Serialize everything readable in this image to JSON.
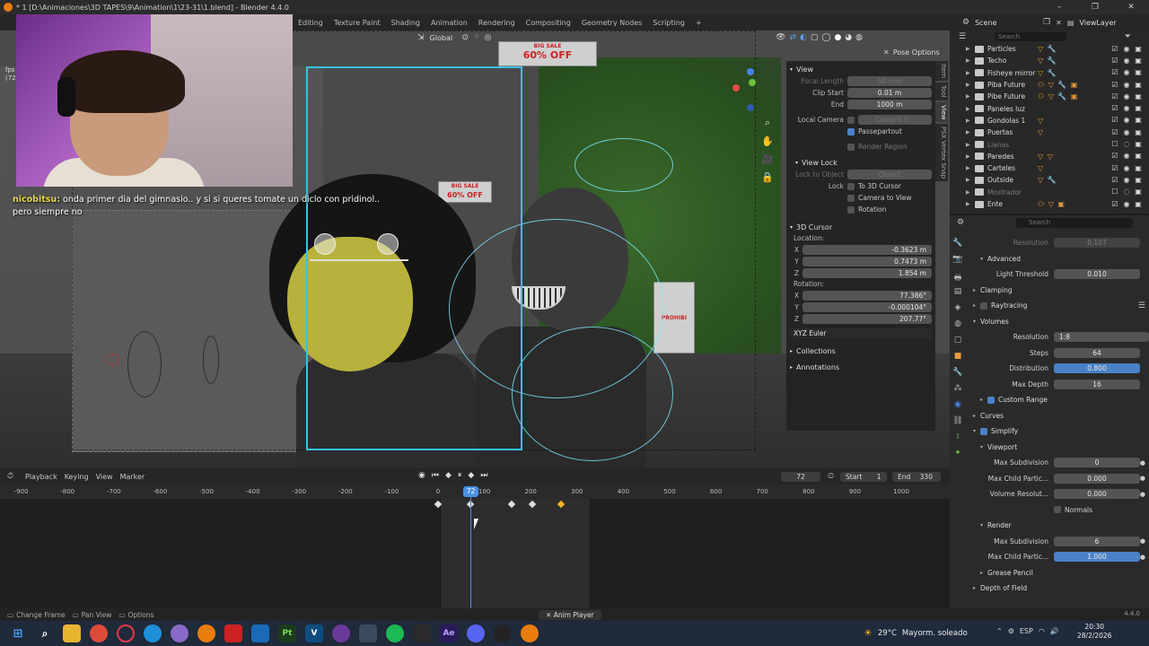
{
  "window": {
    "title": "* 1 [D:\\Animaciones\\3D TAPES\\9\\Animation\\1\\23-31\\1.blend] - Blender 4.4.0",
    "minimize": "–",
    "maximize": "❐",
    "close": "✕"
  },
  "workspaces": [
    "Editing",
    "Texture Paint",
    "Shading",
    "Animation",
    "Rendering",
    "Compositing",
    "Geometry Nodes",
    "Scripting",
    "+"
  ],
  "scene": {
    "scene_label": "Scene",
    "viewlayer_label": "ViewLayer"
  },
  "viewport_header": {
    "orientation": "Global",
    "pose_options": "Pose Options"
  },
  "webcam_overlay": {
    "fps_label": "fps",
    "fps_value": "(72"
  },
  "chat": {
    "nick": "nicobitsu:",
    "message": "onda primer dia del gimnasio.. y si si queres tomate un diclo con pridinol..",
    "message2": "pero siempre no"
  },
  "scene_signs": {
    "sale1_big": "BIG SALE",
    "sale1_pct": "60% OFF",
    "sale2_big": "BIG SALE",
    "sale2_pct": "60% OFF",
    "prohib": "PROHIBI"
  },
  "npanel": {
    "view": {
      "title": "View",
      "focal_length_label": "Focal Length",
      "focal_length": "50 mm",
      "clip_start_label": "Clip Start",
      "clip_start": "0.01 m",
      "end_label": "End",
      "end": "1000 m",
      "local_camera_label": "Local Camera",
      "local_camera": "Camera.0...",
      "passepartout": "Passepartout",
      "render_region": "Render Region"
    },
    "view_lock": {
      "title": "View Lock",
      "lock_to_object_label": "Lock to Object",
      "lock_to_object": "Object",
      "lock_label": "Lock",
      "to_3d_cursor": "To 3D Cursor",
      "camera_to_view": "Camera to View",
      "rotation": "Rotation"
    },
    "cursor": {
      "title": "3D Cursor",
      "location_label": "Location:",
      "x_label": "X",
      "x": "-0.3623 m",
      "y_label": "Y",
      "y": "0.7473 m",
      "z_label": "Z",
      "z": "1.854 m",
      "rotation_label": "Rotation:",
      "rx": "77.386°",
      "ry": "-0.000104°",
      "rz": "207.77°",
      "mode": "XYZ Euler"
    },
    "collections": "Collections",
    "annotations": "Annotations"
  },
  "sidetabs": [
    "Item",
    "Tool",
    "View",
    "PSX Vertex Snap"
  ],
  "outliner": {
    "search_placeholder": "Search",
    "rows": [
      {
        "name": "Particles",
        "mods": "▽ 🔧"
      },
      {
        "name": "Techo",
        "mods": "▽ 🔧"
      },
      {
        "name": "Fisheye mirror",
        "mods": "▽ 🔧"
      },
      {
        "name": "Piba Future",
        "mods": "⚇ ▽ 🔧 ▣"
      },
      {
        "name": "Pibe Future",
        "mods": "⚇ ▽ 🔧 ▣"
      },
      {
        "name": "Paneles luz",
        "mods": ""
      },
      {
        "name": "Gondolas 1",
        "mods": "▽"
      },
      {
        "name": "Puertas",
        "mods": "▽"
      },
      {
        "name": "Lianas",
        "mods": "",
        "dim": true
      },
      {
        "name": "Paredes",
        "mods": "▽ ▽"
      },
      {
        "name": "Carteles",
        "mods": "▽"
      },
      {
        "name": "Outside",
        "mods": "▽ 🔧"
      },
      {
        "name": "Mostrador",
        "mods": "",
        "dim": true
      },
      {
        "name": "Ente",
        "mods": "⚇ ▽ ▣"
      }
    ]
  },
  "properties": {
    "search_placeholder": "Search",
    "resolution_label": "Resolution",
    "resolution": "0.107",
    "advanced": "Advanced",
    "light_threshold_label": "Light Threshold",
    "light_threshold": "0.010",
    "clamping": "Clamping",
    "raytracing": "Raytracing",
    "volumes": "Volumes",
    "vol_resolution_label": "Resolution",
    "vol_resolution": "1:8",
    "steps_label": "Steps",
    "steps": "64",
    "distribution_label": "Distribution",
    "distribution": "0.800",
    "max_depth_label": "Max Depth",
    "max_depth": "16",
    "custom_range": "Custom Range",
    "curves": "Curves",
    "simplify": "Simplify",
    "viewport": "Viewport",
    "max_subdivision_label": "Max Subdivision",
    "max_subdivision": "0",
    "max_child_label": "Max Child Partic...",
    "max_child": "0.000",
    "volume_resolution_label": "Volume Resolut...",
    "volume_resolution": "0.000",
    "normals": "Normals",
    "render": "Render",
    "r_max_subdivision": "6",
    "r_max_child": "1.000",
    "grease_pencil": "Grease Pencil",
    "depth_of_field": "Depth of Field"
  },
  "timeline": {
    "menus": [
      "Playback",
      "Keying",
      "View",
      "Marker"
    ],
    "current_frame": "72",
    "start_label": "Start",
    "start": "1",
    "end_label": "End",
    "end": "330",
    "ticks": [
      "-900",
      "-800",
      "-700",
      "-600",
      "-500",
      "-400",
      "-300",
      "-200",
      "-100",
      "0",
      "100",
      "200",
      "300",
      "400",
      "500",
      "600",
      "700",
      "800",
      "900",
      "1000"
    ]
  },
  "statusbar": {
    "change_frame": "Change Frame",
    "pan_view": "Pan View",
    "options": "Options",
    "anim_player": "Anim Player",
    "version": "4.4.0"
  },
  "taskbar": {
    "weather_temp": "29°C",
    "weather_desc": "Mayorm. soleado",
    "lang": "ESP",
    "time": "20:30",
    "date": "28/2/2026"
  },
  "colors": {
    "accent": "#4a82c8",
    "camera_frame": "#36c2e0",
    "keyframe_selected": "#f0b429"
  }
}
